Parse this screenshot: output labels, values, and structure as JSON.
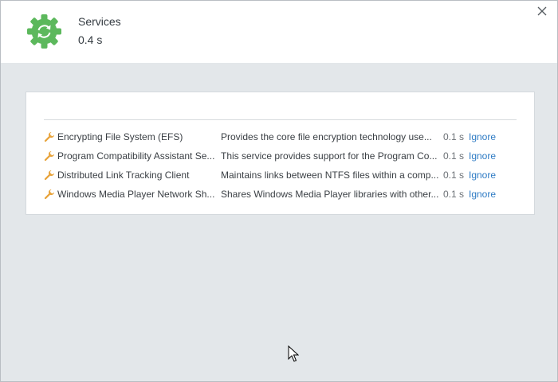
{
  "header": {
    "title": "Services",
    "duration": "0.4 s",
    "accent_color": "#5cb85c",
    "icon": "refresh-gear-icon"
  },
  "items": [
    {
      "name": "Encrypting File System (EFS)",
      "description": "Provides the core file encryption technology use...",
      "time": "0.1 s",
      "action": "Ignore"
    },
    {
      "name": "Program Compatibility Assistant Se...",
      "description": "This service provides support for the Program Co...",
      "time": "0.1 s",
      "action": "Ignore"
    },
    {
      "name": "Distributed Link Tracking Client",
      "description": "Maintains links between NTFS files within a comp...",
      "time": "0.1 s",
      "action": "Ignore"
    },
    {
      "name": "Windows Media Player Network Sh...",
      "description": "Shares Windows Media Player libraries with other...",
      "time": "0.1 s",
      "action": "Ignore"
    }
  ],
  "link_color": "#2e7bc4",
  "item_icon": "wrench-icon"
}
